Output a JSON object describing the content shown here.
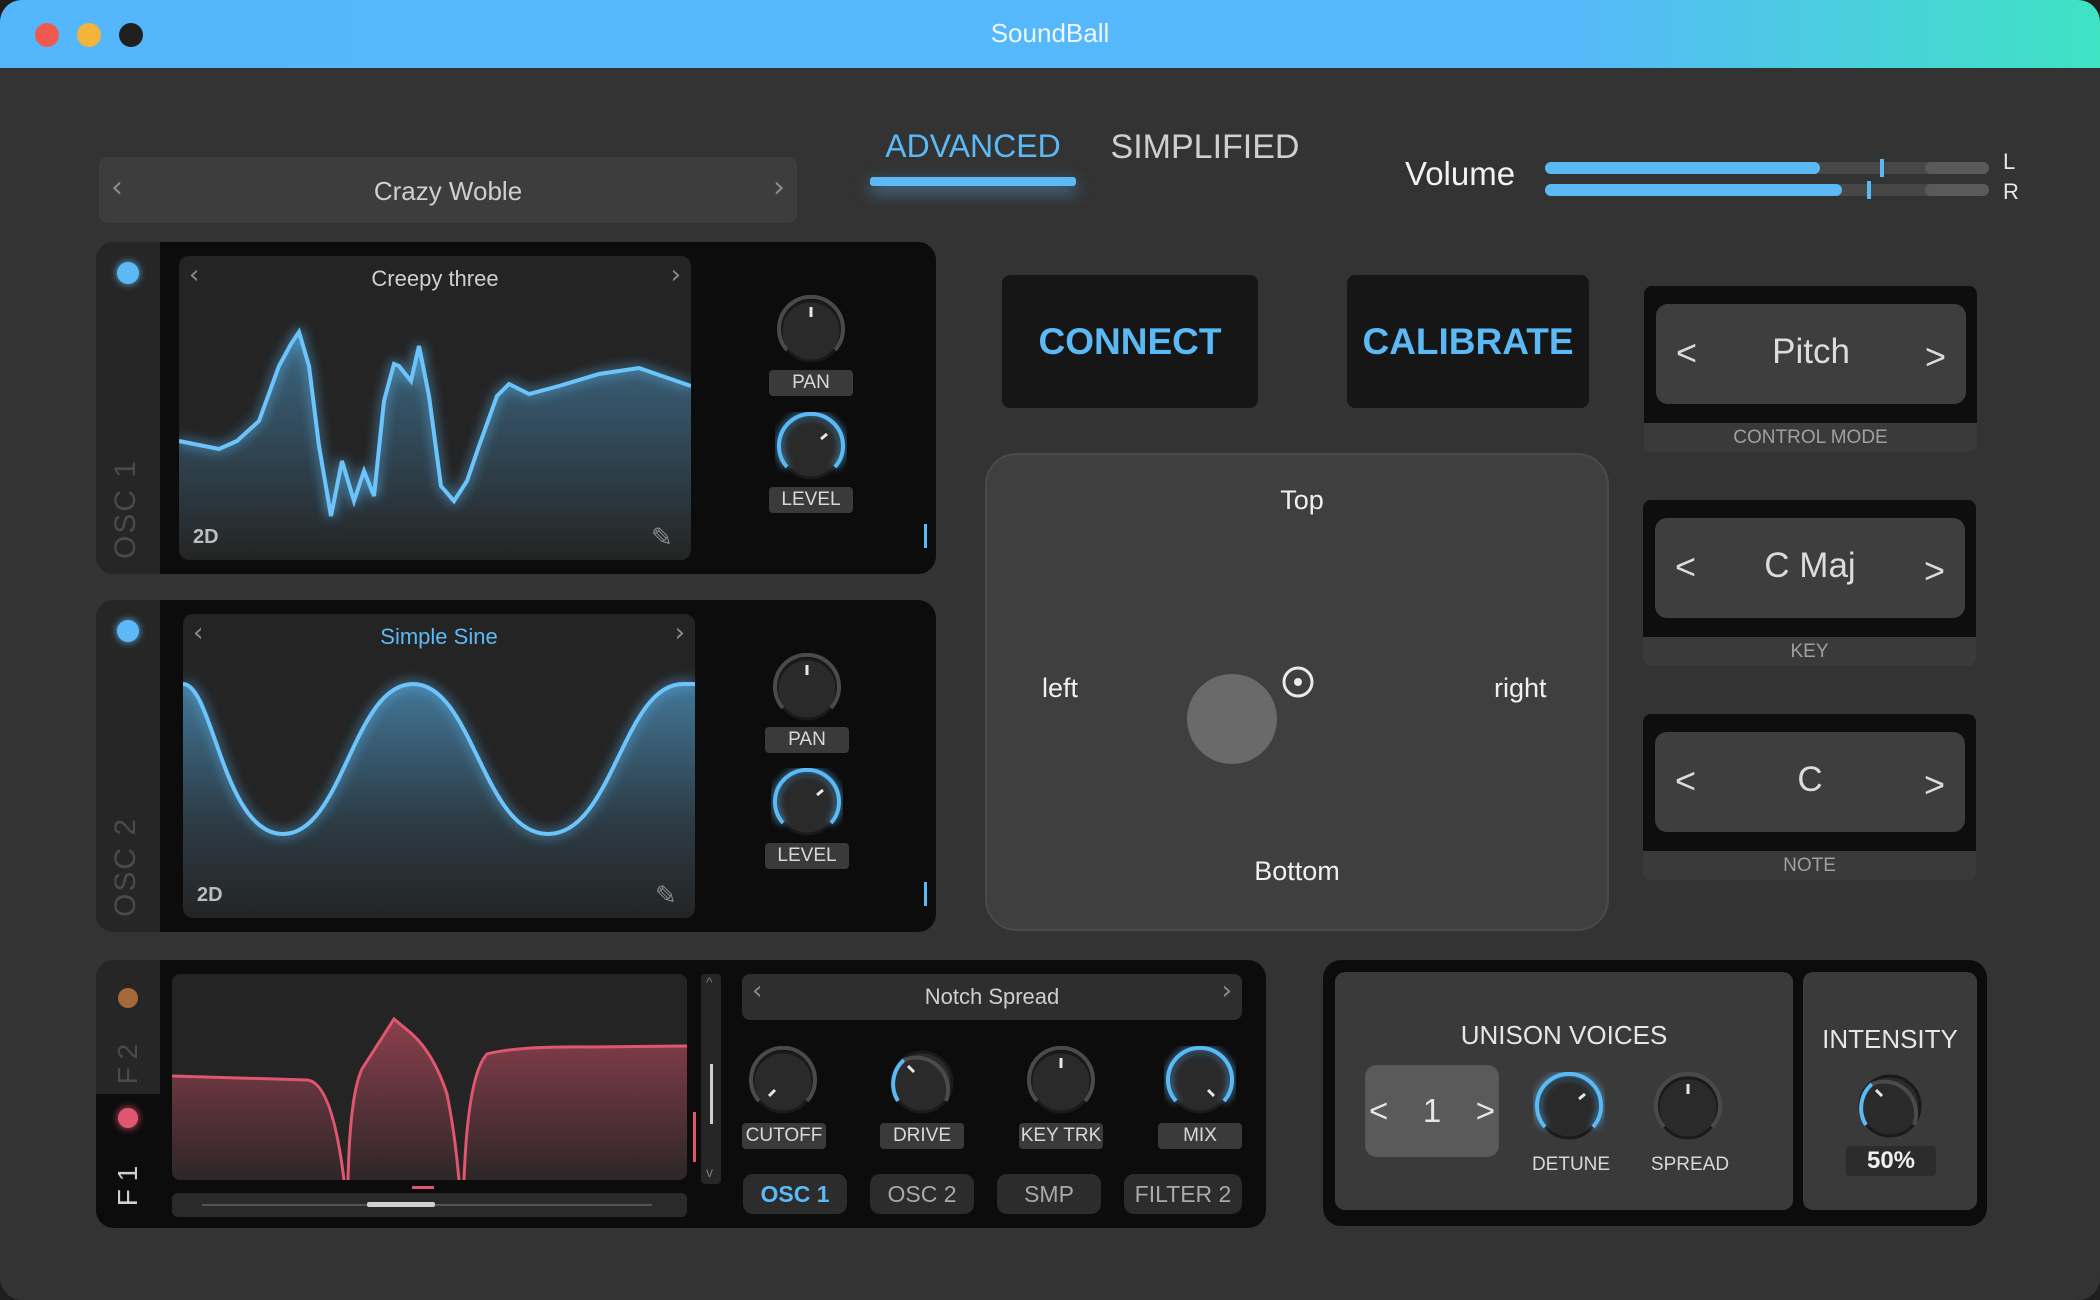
{
  "window": {
    "title": "SoundBall"
  },
  "preset": {
    "name": "Crazy Woble"
  },
  "mode_tabs": {
    "advanced": "ADVANCED",
    "simplified": "SIMPLIFIED"
  },
  "volume": {
    "label": "Volume",
    "left_label": "L",
    "right_label": "R",
    "left_level": 0.62,
    "right_level": 0.67
  },
  "osc1": {
    "label": "OSC 1",
    "wave_name": "Creepy three",
    "mode": "2D",
    "pan_label": "PAN",
    "level_label": "LEVEL"
  },
  "osc2": {
    "label": "OSC 2",
    "wave_name": "Simple Sine",
    "mode": "2D",
    "pan_label": "PAN",
    "level_label": "LEVEL"
  },
  "actions": {
    "connect": "CONNECT",
    "calibrate": "CALIBRATE"
  },
  "pad": {
    "top": "Top",
    "bottom": "Bottom",
    "left": "left",
    "right": "right"
  },
  "control_mode": {
    "value": "Pitch",
    "caption": "CONTROL MODE"
  },
  "key": {
    "value": "C Maj",
    "caption": "KEY"
  },
  "note": {
    "value": "C",
    "caption": "NOTE"
  },
  "filter": {
    "tab_f2": "F 2",
    "tab_f1": "F 1",
    "type_name": "Notch Spread",
    "knobs": {
      "cutoff": "CUTOFF",
      "drive": "DRIVE",
      "keytrk": "KEY TRK",
      "mix": "MIX"
    },
    "routes": {
      "osc1": "OSC 1",
      "osc2": "OSC 2",
      "smp": "SMP",
      "filter2": "FILTER 2"
    }
  },
  "unison": {
    "title": "UNISON VOICES",
    "value": "1",
    "detune": "DETUNE",
    "spread": "SPREAD"
  },
  "intensity": {
    "title": "INTENSITY",
    "value": "50%"
  },
  "icons": {
    "prev": "‹",
    "next": "›",
    "lt": "<",
    "gt": ">"
  },
  "colors": {
    "accent": "#5bbaf6",
    "filter": "#e0566e",
    "f2_dot": "#c97a3f"
  }
}
